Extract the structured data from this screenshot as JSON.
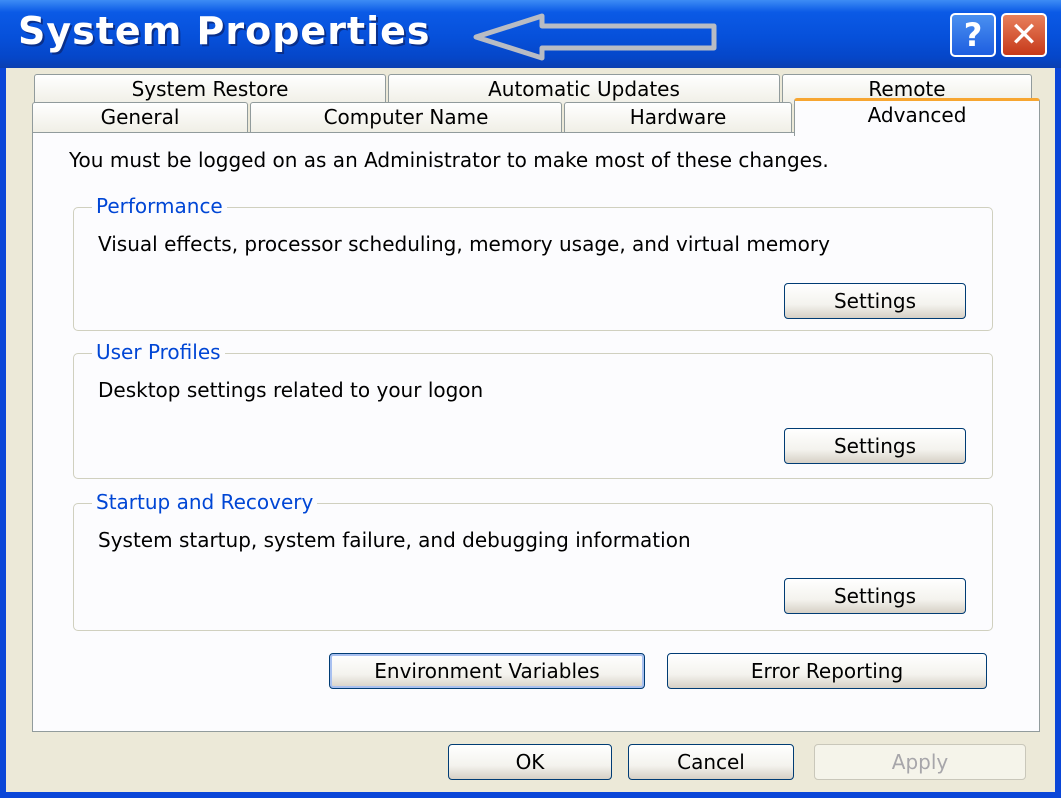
{
  "window": {
    "title": "System Properties",
    "help_glyph": "?",
    "close_glyph": "✕"
  },
  "tabs": {
    "row1": [
      "System Restore",
      "Automatic Updates",
      "Remote"
    ],
    "row2": [
      "General",
      "Computer Name",
      "Hardware",
      "Advanced"
    ],
    "active": "Advanced"
  },
  "advanced": {
    "info": "You must be logged on as an Administrator to make most of these changes.",
    "performance": {
      "legend": "Performance",
      "description": "Visual effects, processor scheduling, memory usage, and virtual memory",
      "settings_label": "Settings"
    },
    "user_profiles": {
      "legend": "User Profiles",
      "description": "Desktop settings related to your logon",
      "settings_label": "Settings"
    },
    "startup_recovery": {
      "legend": "Startup and Recovery",
      "description": "System startup, system failure, and debugging information",
      "settings_label": "Settings"
    },
    "environment_variables_label": "Environment Variables",
    "error_reporting_label": "Error Reporting"
  },
  "footer": {
    "ok_label": "OK",
    "cancel_label": "Cancel",
    "apply_label": "Apply"
  },
  "annotations": {
    "arrow_color": "#e01818",
    "title_arrow_color": "#b8bcc4"
  }
}
